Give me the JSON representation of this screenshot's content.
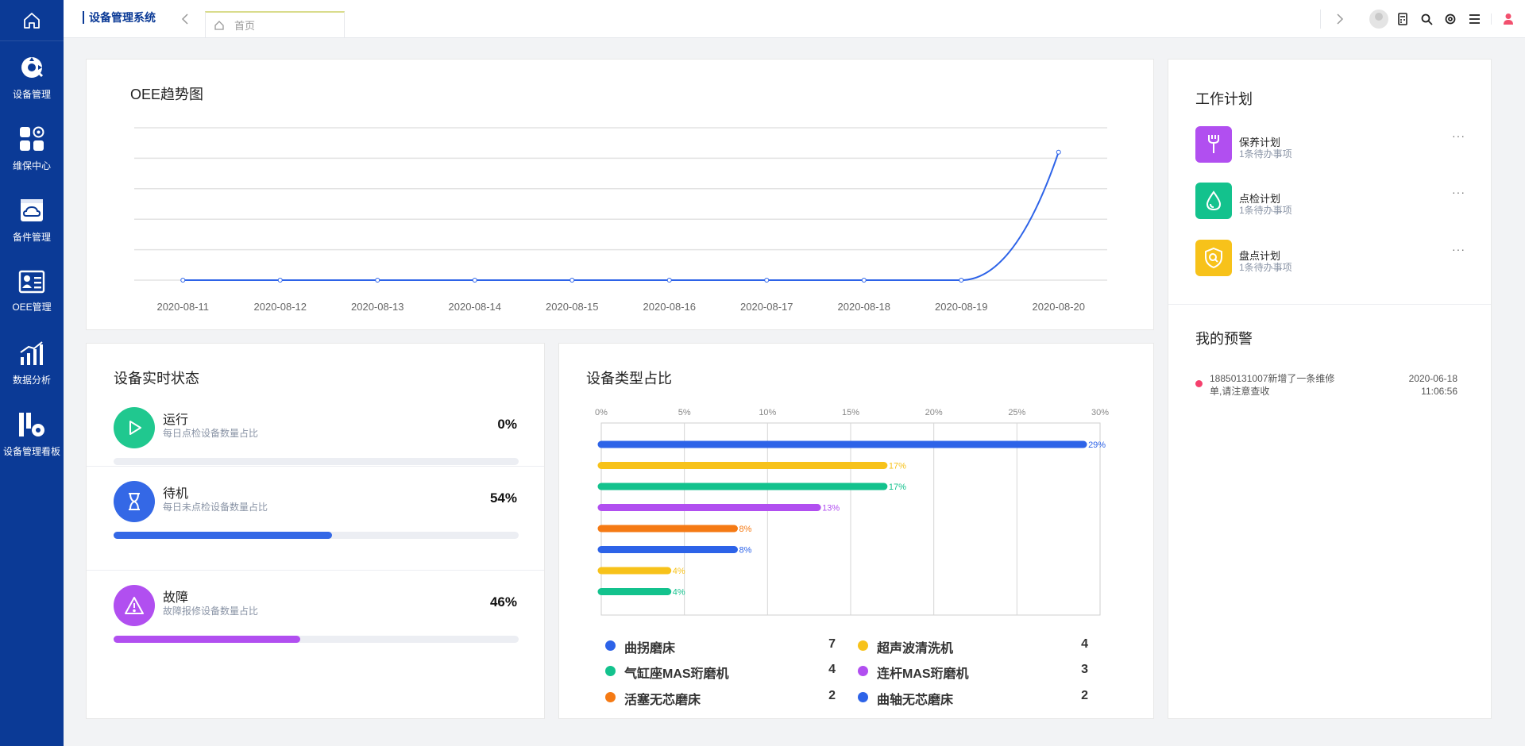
{
  "sidebar": {
    "home_icon": "home-icon",
    "items": [
      {
        "label": "设备管理",
        "icon": "equipment-gear-icon"
      },
      {
        "label": "维保中心",
        "icon": "grid-gear-icon"
      },
      {
        "label": "备件管理",
        "icon": "cloud-box-icon"
      },
      {
        "label": "OEE管理",
        "icon": "id-card-icon"
      },
      {
        "label": "数据分析",
        "icon": "bar-chart-icon"
      },
      {
        "label": "设备管理看板",
        "icon": "building-gear-icon"
      }
    ]
  },
  "topbar": {
    "system_title": "设备管理系统",
    "tab_home": "首页",
    "right_icons": [
      "avatar",
      "calculator-icon",
      "search-icon",
      "settings-icon",
      "menu-icon",
      "user-icon"
    ]
  },
  "oee": {
    "title": "OEE趋势图"
  },
  "chart_data": [
    {
      "type": "line",
      "title": "OEE趋势图",
      "x": [
        "2020-08-11",
        "2020-08-12",
        "2020-08-13",
        "2020-08-14",
        "2020-08-15",
        "2020-08-16",
        "2020-08-17",
        "2020-08-18",
        "2020-08-19",
        "2020-08-20"
      ],
      "series": [
        {
          "values": [
            0,
            0,
            0,
            0,
            0,
            0,
            0,
            0,
            0,
            0.84
          ]
        }
      ],
      "ylim": [
        0,
        1
      ],
      "grid": true,
      "color": "#2d63e8"
    },
    {
      "type": "bar",
      "orientation": "horizontal",
      "title": "设备类型占比",
      "x_ticks": [
        "0%",
        "5%",
        "10%",
        "15%",
        "20%",
        "25%",
        "30%"
      ],
      "xlim": [
        0,
        30
      ],
      "values": [
        29,
        17,
        17,
        13,
        8,
        8,
        4,
        4
      ],
      "labels": [
        "29%",
        "17%",
        "17%",
        "13%",
        "8%",
        "8%",
        "4%",
        "4%"
      ],
      "colors": [
        "#2d63e8",
        "#f7c21a",
        "#13c28d",
        "#b14ff0",
        "#f57a14",
        "#2d63e8",
        "#f7c21a",
        "#13c28d"
      ]
    }
  ],
  "plan": {
    "title": "工作计划",
    "items": [
      {
        "name": "保养计划",
        "sub": "1条待办事项",
        "icon": "wrench-icon",
        "color": "#b14ff0",
        "more": "···"
      },
      {
        "name": "点检计划",
        "sub": "1条待办事项",
        "icon": "droplet-icon",
        "color": "#13c28d",
        "more": "···"
      },
      {
        "name": "盘点计划",
        "sub": "1条待办事项",
        "icon": "shield-search-icon",
        "color": "#f7c21a",
        "more": "···"
      }
    ],
    "warn_title": "我的预警",
    "warning": {
      "text": "18850131007新增了一条维修单,请注意查收",
      "date": "2020-06-18",
      "time": "11:06:56",
      "color": "#f5406d"
    }
  },
  "status": {
    "title": "设备实时状态",
    "rows": [
      {
        "name": "运行",
        "sub": "每日点检设备数量占比",
        "pct_label": "0%",
        "pct": 0,
        "color": "#20c88f",
        "icon": "play-icon"
      },
      {
        "name": "待机",
        "sub": "每日未点检设备数量占比",
        "pct_label": "54%",
        "pct": 54,
        "color": "#3468e6",
        "icon": "hourglass-icon"
      },
      {
        "name": "故障",
        "sub": "故障报修设备数量占比",
        "pct_label": "46%",
        "pct": 46,
        "color": "#b14ff0",
        "icon": "warning-icon"
      }
    ]
  },
  "types": {
    "title": "设备类型占比",
    "legend": [
      {
        "name": "曲拐磨床",
        "value": "7",
        "color": "#2d63e8"
      },
      {
        "name": "超声波清洗机",
        "value": "4",
        "color": "#f7c21a"
      },
      {
        "name": "气缸座MAS珩磨机",
        "value": "4",
        "color": "#13c28d"
      },
      {
        "name": "连杆MAS珩磨机",
        "value": "3",
        "color": "#b14ff0"
      },
      {
        "name": "活塞无芯磨床",
        "value": "2",
        "color": "#f57a14"
      },
      {
        "name": "曲轴无芯磨床",
        "value": "2",
        "color": "#2d63e8"
      }
    ]
  }
}
